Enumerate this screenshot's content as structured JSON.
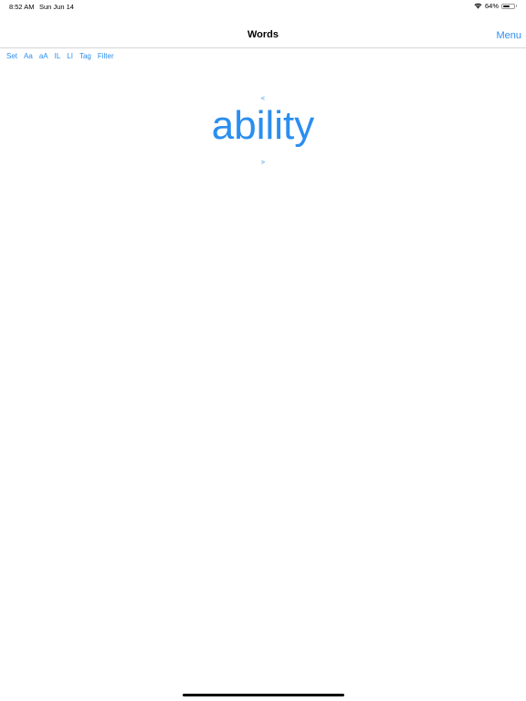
{
  "status_bar": {
    "time": "8:52 AM",
    "date": "Sun Jun 14",
    "battery_percent": "64%",
    "battery_level": 0.64,
    "wifi_icon": "wifi-icon",
    "battery_icon": "battery-icon"
  },
  "nav": {
    "title": "Words",
    "menu_label": "Menu"
  },
  "toolbar": {
    "items": [
      "Set",
      "Aa",
      "aA",
      "IL",
      "LI",
      "Tag",
      "Filter"
    ]
  },
  "word_view": {
    "prev_label": "<",
    "word": "ability",
    "next_label": ">"
  },
  "colors": {
    "accent": "#2a8ef0",
    "text": "#000000",
    "background": "#ffffff"
  }
}
